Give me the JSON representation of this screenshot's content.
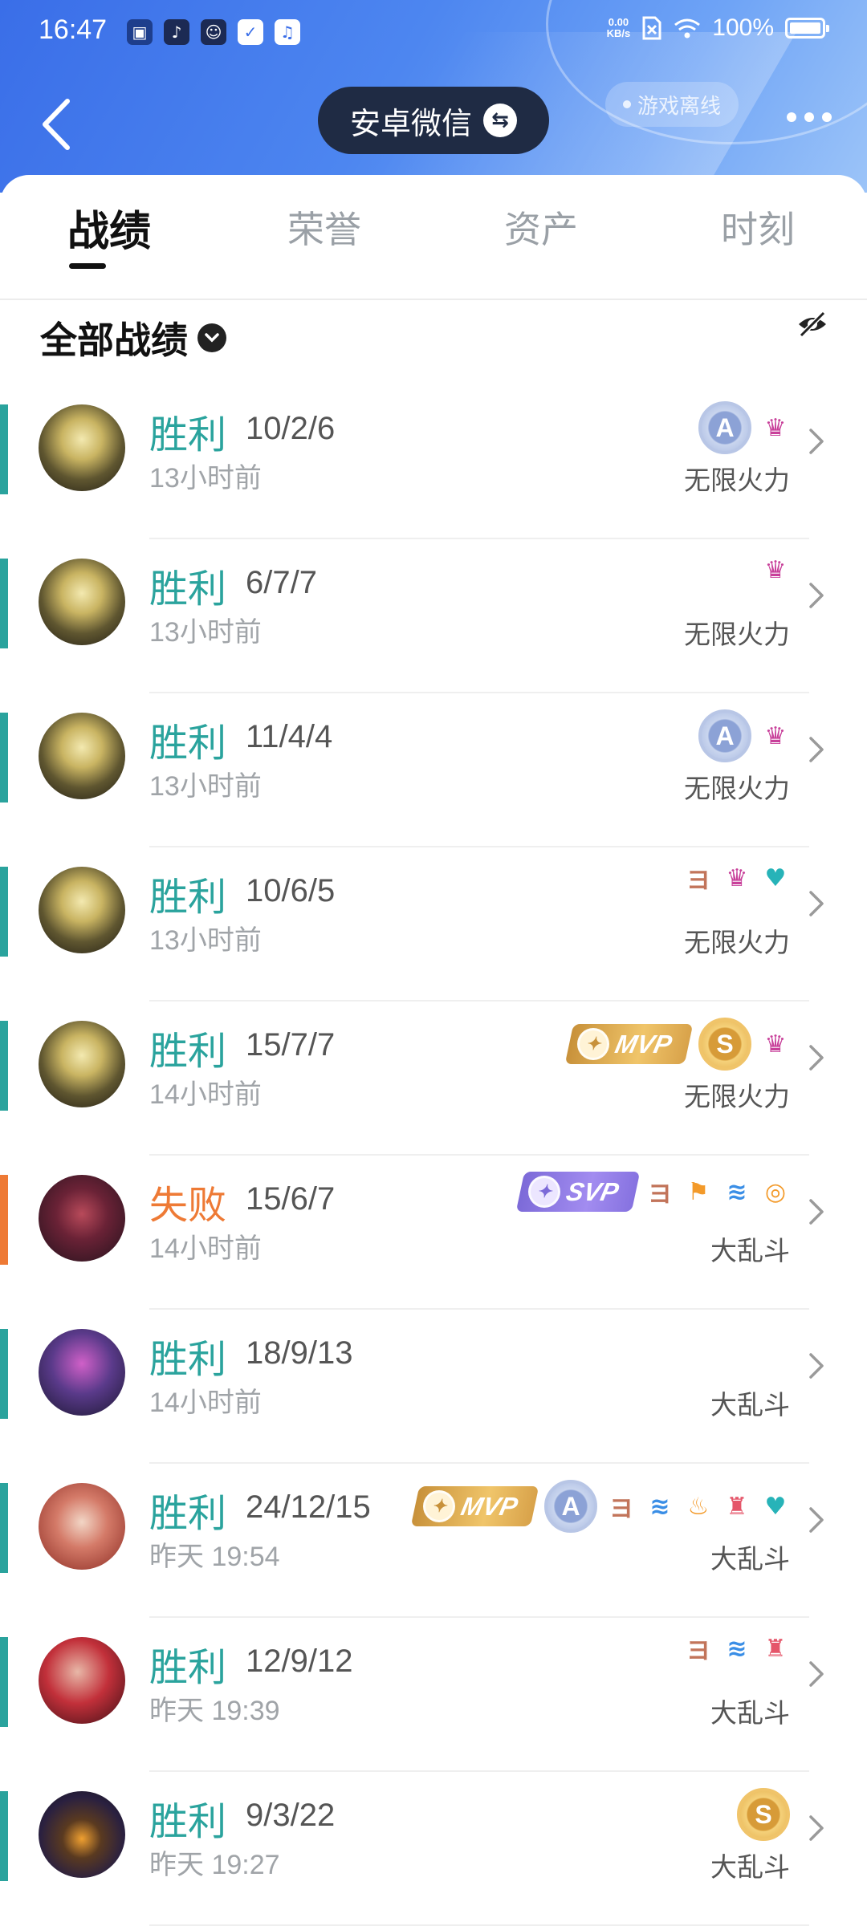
{
  "status_bar": {
    "time": "16:47",
    "app_icons": [
      "app-icon",
      "tiktok-icon",
      "chat-icon",
      "check-icon",
      "music-icon"
    ],
    "net_speed_value": "0.00",
    "net_speed_unit": "KB/s",
    "battery": "100%"
  },
  "header": {
    "account_name": "安卓微信",
    "offline_label": "游戏离线",
    "colors": {
      "gradient_start": "#3a6ee8",
      "gradient_end": "#9cc4f8",
      "pill": "#1f2b44"
    }
  },
  "tabs": [
    {
      "label": "战绩",
      "active": true
    },
    {
      "label": "荣誉",
      "active": false
    },
    {
      "label": "资产",
      "active": false
    },
    {
      "label": "时刻",
      "active": false
    }
  ],
  "filter": {
    "label": "全部战绩"
  },
  "colors": {
    "win": "#2aa39d",
    "loss": "#ee7a35"
  },
  "matches": [
    {
      "result": "胜利",
      "outcome": "win",
      "kda": "10/2/6",
      "time": "13小时前",
      "mode": "无限火力",
      "hero": "gold-mech",
      "badges": [
        {
          "type": "medal-silver",
          "text": "A"
        },
        {
          "type": "small",
          "icon": "lotus-icon",
          "glyph": "♛",
          "color": "c-pink"
        }
      ]
    },
    {
      "result": "胜利",
      "outcome": "win",
      "kda": "6/7/7",
      "time": "13小时前",
      "mode": "无限火力",
      "hero": "gold-mech",
      "badges": [
        {
          "type": "small",
          "icon": "lotus-icon",
          "glyph": "♛",
          "color": "c-pink"
        }
      ]
    },
    {
      "result": "胜利",
      "outcome": "win",
      "kda": "11/4/4",
      "time": "13小时前",
      "mode": "无限火力",
      "hero": "gold-mech",
      "badges": [
        {
          "type": "medal-silver",
          "text": "A"
        },
        {
          "type": "small",
          "icon": "lotus-icon",
          "glyph": "♛",
          "color": "c-pink"
        }
      ]
    },
    {
      "result": "胜利",
      "outcome": "win",
      "kda": "10/6/5",
      "time": "13小时前",
      "mode": "无限火力",
      "hero": "gold-mech",
      "badges": [
        {
          "type": "small",
          "icon": "triple-kill-icon",
          "glyph": "ヨ",
          "color": "c-brown"
        },
        {
          "type": "small",
          "icon": "lotus-icon",
          "glyph": "♛",
          "color": "c-pink"
        },
        {
          "type": "small",
          "icon": "heart-plus-icon",
          "glyph": "♥",
          "color": "c-teal"
        }
      ]
    },
    {
      "result": "胜利",
      "outcome": "win",
      "kda": "15/7/7",
      "time": "14小时前",
      "mode": "无限火力",
      "hero": "gold-mech",
      "badges": [
        {
          "type": "mvp-gold",
          "text": "MVP"
        },
        {
          "type": "medal-gold",
          "text": "S"
        },
        {
          "type": "small",
          "icon": "lotus-icon",
          "glyph": "♛",
          "color": "c-pink"
        }
      ]
    },
    {
      "result": "失败",
      "outcome": "loss",
      "kda": "15/6/7",
      "time": "14小时前",
      "mode": "大乱斗",
      "hero": "dark-mage",
      "badges": [
        {
          "type": "mvp-purple",
          "text": "SVP"
        },
        {
          "type": "small",
          "icon": "triple-kill-icon",
          "glyph": "ヨ",
          "color": "c-brown"
        },
        {
          "type": "small",
          "icon": "flag-icon",
          "glyph": "⚑",
          "color": "c-orange"
        },
        {
          "type": "small",
          "icon": "wave-icon",
          "glyph": "≋",
          "color": "c-blue"
        },
        {
          "type": "small",
          "icon": "coins-icon",
          "glyph": "◎",
          "color": "c-orange"
        }
      ]
    },
    {
      "result": "胜利",
      "outcome": "win",
      "kda": "18/9/13",
      "time": "14小时前",
      "mode": "大乱斗",
      "hero": "purple-assassin",
      "badges": []
    },
    {
      "result": "胜利",
      "outcome": "win",
      "kda": "24/12/15",
      "time": "昨天 19:54",
      "mode": "大乱斗",
      "hero": "red-warrior",
      "badges": [
        {
          "type": "mvp-gold",
          "text": "MVP"
        },
        {
          "type": "medal-silver",
          "text": "A"
        },
        {
          "type": "small",
          "icon": "triple-kill-icon",
          "glyph": "ヨ",
          "color": "c-brown"
        },
        {
          "type": "small",
          "icon": "wave-icon",
          "glyph": "≋",
          "color": "c-blue"
        },
        {
          "type": "small",
          "icon": "fire-icon",
          "glyph": "♨",
          "color": "c-orange"
        },
        {
          "type": "small",
          "icon": "tower-icon",
          "glyph": "♜",
          "color": "c-red"
        },
        {
          "type": "small",
          "icon": "heart-plus-icon",
          "glyph": "♥",
          "color": "c-teal"
        }
      ]
    },
    {
      "result": "胜利",
      "outcome": "win",
      "kda": "12/9/12",
      "time": "昨天 19:39",
      "mode": "大乱斗",
      "hero": "red-hair",
      "badges": [
        {
          "type": "small",
          "icon": "triple-kill-icon",
          "glyph": "ヨ",
          "color": "c-brown"
        },
        {
          "type": "small",
          "icon": "wave-icon",
          "glyph": "≋",
          "color": "c-blue"
        },
        {
          "type": "small",
          "icon": "tower-icon",
          "glyph": "♜",
          "color": "c-red"
        }
      ]
    },
    {
      "result": "胜利",
      "outcome": "win",
      "kda": "9/3/22",
      "time": "昨天 19:27",
      "mode": "大乱斗",
      "hero": "hooded-mage",
      "badges": [
        {
          "type": "medal-gold",
          "text": "S"
        }
      ]
    }
  ]
}
